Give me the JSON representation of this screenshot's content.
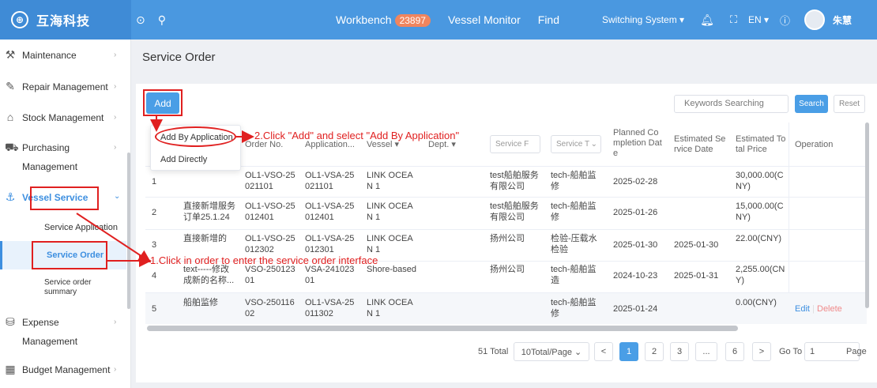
{
  "app": {
    "logo_mark": "⊕",
    "logo_text": "互海科技"
  },
  "topbar": {
    "workbench_label": "Workbench",
    "workbench_count": "23897",
    "vessel_monitor_label": "Vessel Monitor",
    "find_label": "Find",
    "switching_system_label": "Switching System ▾",
    "lang_label": "EN ▾",
    "user_name": "朱慧"
  },
  "sidebar": {
    "items": [
      {
        "label": "Maintenance"
      },
      {
        "label": "Repair Management"
      },
      {
        "label": "Stock Management"
      },
      {
        "label": "Purchasing",
        "label2": "Management"
      },
      {
        "label": "Vessel Service"
      },
      {
        "label": "Expense",
        "label2": "Management"
      },
      {
        "label": "Budget Management"
      }
    ],
    "submenu": [
      {
        "label": "Service Application"
      },
      {
        "label": "Service Order"
      },
      {
        "label": "Service order",
        "label2": "summary"
      }
    ]
  },
  "page": {
    "title": "Service Order"
  },
  "toolbar": {
    "add_label": "Add",
    "keywords_placeholder": "Keywords Searching",
    "search_label": "Search",
    "reset_label": "Reset"
  },
  "dropdown": {
    "items": [
      "Add By Application",
      "Add Directly"
    ]
  },
  "annotations": {
    "step2": "2.Click \"Add\" and select \"Add By Application\"",
    "step1": "1.Click in order to enter the service order interface"
  },
  "table": {
    "headers": {
      "order_no": "Order No.",
      "application": "Application...",
      "vessel": "Vessel ▾",
      "dept": "Dept. ▾",
      "service_filter": "Service F",
      "service_type_filter": "Service T",
      "planned": [
        "Planned Co",
        "mpletion Dat",
        "e"
      ],
      "estimated_date": [
        "Estimated Se",
        "rvice Date"
      ],
      "estimated_price": [
        "Estimated To",
        "tal Price"
      ],
      "operation": "Operation"
    },
    "rows": [
      {
        "idx": "1",
        "name": [
          "",
          ""
        ],
        "order": [
          "OL1-VSO-25",
          "021101"
        ],
        "app": [
          "OL1-VSA-25",
          "021101"
        ],
        "vessel": [
          "LINK OCEA",
          "N 1"
        ],
        "provider": [
          "test船舶服务",
          "有限公司"
        ],
        "type": [
          "tech-船舶监",
          "修"
        ],
        "planned": "2025-02-28",
        "est_date": "",
        "price": [
          "30,000.00(C",
          "NY)"
        ],
        "edit": "",
        "del": ""
      },
      {
        "idx": "2",
        "name": [
          "直接新增服务",
          "订单25.1.24"
        ],
        "order": [
          "OL1-VSO-25",
          "012401"
        ],
        "app": [
          "OL1-VSA-25",
          "012401"
        ],
        "vessel": [
          "LINK OCEA",
          "N 1"
        ],
        "provider": [
          "test船舶服务",
          "有限公司"
        ],
        "type": [
          "tech-船舶监",
          "修"
        ],
        "planned": "2025-01-26",
        "est_date": "",
        "price": [
          "15,000.00(C",
          "NY)"
        ],
        "edit": "",
        "del": ""
      },
      {
        "idx": "3",
        "name": [
          "直接新增的",
          ""
        ],
        "order": [
          "OL1-VSO-25",
          "012302"
        ],
        "app": [
          "OL1-VSA-25",
          "012301"
        ],
        "vessel": [
          "LINK OCEA",
          "N 1"
        ],
        "provider": [
          "扬州公司",
          ""
        ],
        "type": [
          "检验-压载水",
          "检验"
        ],
        "planned": "2025-01-30",
        "est_date": "2025-01-30",
        "price": [
          "22.00(CNY)",
          ""
        ],
        "edit": "",
        "del": ""
      },
      {
        "idx": "4",
        "name": [
          "text-----修改",
          "成新的名称..."
        ],
        "order": [
          "VSO-250123",
          "01"
        ],
        "app": [
          "VSA-241023",
          "01"
        ],
        "vessel": [
          "Shore-based",
          ""
        ],
        "provider": [
          "扬州公司",
          ""
        ],
        "type": [
          "tech-船舶监",
          "造"
        ],
        "planned": "2024-10-23",
        "est_date": "2025-01-31",
        "price": [
          "2,255.00(CN",
          "Y)"
        ],
        "edit": "",
        "del": ""
      },
      {
        "idx": "5",
        "name": [
          "船舶监修",
          ""
        ],
        "order": [
          "VSO-250116",
          "02"
        ],
        "app": [
          "OL1-VSA-25",
          "011302"
        ],
        "vessel": [
          "LINK OCEA",
          "N 1"
        ],
        "provider": [
          "",
          ""
        ],
        "type": [
          "tech-船舶监",
          "修"
        ],
        "planned": "2025-01-24",
        "est_date": "",
        "price": [
          "0.00(CNY)",
          ""
        ],
        "edit": "Edit",
        "del": "Delete"
      }
    ]
  },
  "pagination": {
    "total": "51 Total",
    "per_page": "10Total/Page ⌄",
    "prev": "<",
    "pages": [
      "1",
      "2",
      "3",
      "...",
      "6"
    ],
    "next": ">",
    "goto_label": "Go To",
    "goto_value": "1",
    "page_label": "Page"
  },
  "colors": {
    "primary": "#4a98e0",
    "annotation": "#e02020"
  }
}
